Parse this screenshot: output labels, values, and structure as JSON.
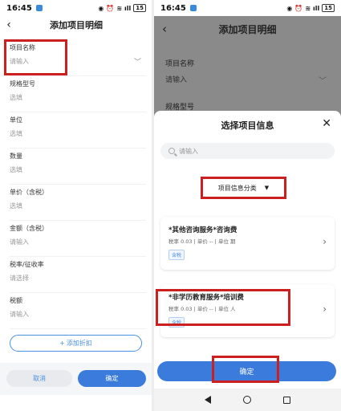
{
  "status_bar": {
    "time": "16:45",
    "battery": "15",
    "signal": "ıll"
  },
  "left": {
    "title": "添加项目明细",
    "fields": [
      {
        "label": "项目名称",
        "value": "请输入"
      },
      {
        "label": "规格型号",
        "value": "选填"
      },
      {
        "label": "单位",
        "value": "选填"
      },
      {
        "label": "数量",
        "value": "选填"
      },
      {
        "label": "单价（含税）",
        "value": "选填"
      },
      {
        "label": "金额（含税）",
        "value": "请输入"
      },
      {
        "label": "税率/征收率",
        "value": "请选择"
      },
      {
        "label": "税额",
        "value": "请输入"
      }
    ],
    "add_discount": "添加折扣",
    "cancel": "取消",
    "confirm": "确定"
  },
  "right": {
    "title": "添加项目明细",
    "bg_field1_label": "项目名称",
    "bg_field1_value": "请输入",
    "bg_field2_label": "规格型号",
    "sheet_title": "选择项目信息",
    "search_placeholder": "请输入",
    "category_button": "项目信息分类",
    "items": [
      {
        "name": "*其他咨询服务*咨询费",
        "meta": "税率 0.03 | 单价 -- | 单位 期",
        "tag": "含税"
      },
      {
        "name": "*非学历教育服务*培训费",
        "meta": "税率 0.03 | 单价 -- | 单位 人",
        "tag": "含税"
      }
    ],
    "confirm": "确定"
  }
}
